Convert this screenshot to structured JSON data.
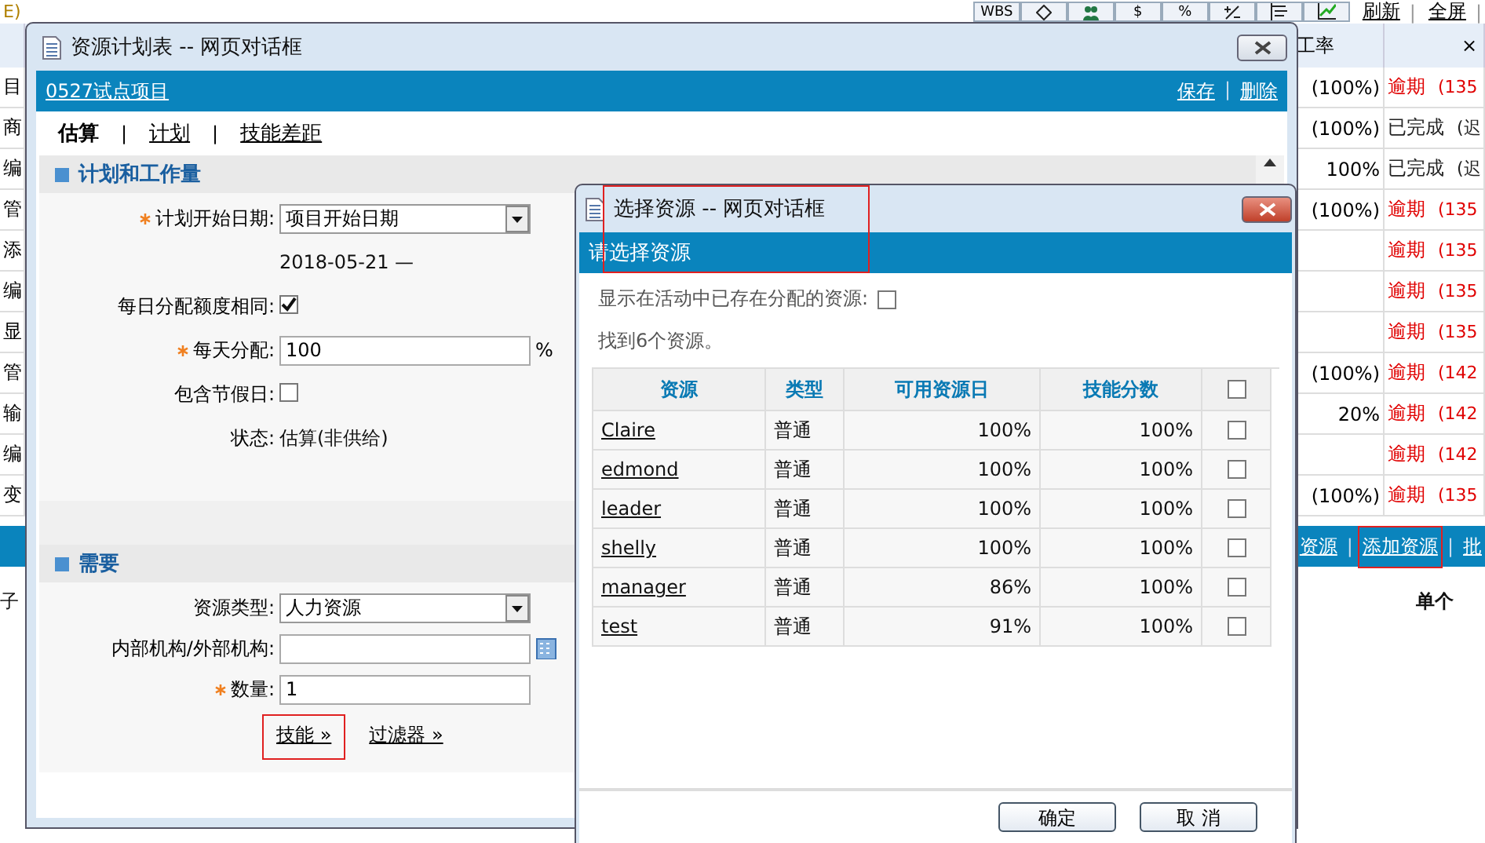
{
  "background": {
    "corner_text": "E)",
    "toolbar": [
      {
        "kind": "text",
        "label": "WBS"
      },
      {
        "kind": "diamond"
      },
      {
        "kind": "people"
      },
      {
        "kind": "text",
        "label": "$"
      },
      {
        "kind": "text",
        "label": "%"
      },
      {
        "kind": "plus-minus"
      },
      {
        "kind": "list"
      },
      {
        "kind": "chart"
      }
    ],
    "toolbar_links": [
      "刷新",
      "全屏"
    ],
    "table": {
      "columns": [
        "工率",
        "×"
      ],
      "rows": [
        {
          "column_1": "目",
          "column_2": "(100%)",
          "color": "#e00000",
          "column_3": "逾期",
          "note": "(135"
        },
        {
          "column_1": "商",
          "column_2": "(100%)",
          "color": "#222222",
          "column_3": "已完成",
          "note": "(迟"
        },
        {
          "column_1": "编",
          "column_2": "100%",
          "color": "#222222",
          "column_3": "已完成",
          "note": "(迟"
        },
        {
          "column_1": "管",
          "column_2": "(100%)",
          "color": "#e00000",
          "column_3": "逾期",
          "note": "(135"
        },
        {
          "column_1": "添",
          "color": "#e00000",
          "column_3": "逾期",
          "note": "(135"
        },
        {
          "column_1": "编",
          "color": "#e00000",
          "column_3": "逾期",
          "note": "(135"
        },
        {
          "column_1": "显",
          "color": "#e00000",
          "column_3": "逾期",
          "note": "(135"
        },
        {
          "column_1": "管",
          "column_2": "(100%)",
          "color": "#e00000",
          "column_3": "逾期",
          "note": "(142"
        },
        {
          "column_1": "输",
          "column_2": "20%",
          "color": "#e00000",
          "column_3": "逾期",
          "note": "(142"
        },
        {
          "column_1": "编",
          "color": "#e00000",
          "column_3": "逾期",
          "note": "(142"
        },
        {
          "column_1": "变",
          "column_2": "(100%)",
          "color": "#e00000",
          "column_3": "逾期",
          "note": "(135"
        }
      ]
    },
    "separator": "|",
    "action_bar": [
      {
        "label": "资源",
        "highlighted": false
      },
      {
        "label": "添加资源",
        "highlighted": true
      },
      {
        "label": "批",
        "highlighted": false
      }
    ],
    "below_left": "子",
    "below_right": "单个"
  },
  "plan_dialog": {
    "title": "资源计划表 -- 网页对话框",
    "project": "0527试点项目",
    "actions": [
      "保存",
      "删除"
    ],
    "tabs": [
      {
        "label": "估算",
        "selected": true
      },
      {
        "label": "计划",
        "selected": false
      },
      {
        "label": "技能差距",
        "selected": false
      }
    ],
    "sections": [
      {
        "title": "计划和工作量",
        "fields": [
          {
            "kind": "select",
            "label": "计划开始日期:",
            "required": true,
            "value": "项目开始日期"
          },
          {
            "kind": "text",
            "value": "2018-05-21 —"
          },
          {
            "kind": "checkbox",
            "label": "每日分配额度相同:",
            "required": false,
            "checked": true
          },
          {
            "kind": "input",
            "label": "每天分配:",
            "required": true,
            "value": "100",
            "unit": "%"
          },
          {
            "kind": "checkbox",
            "label": "包含节假日:",
            "required": false,
            "checked": false
          },
          {
            "kind": "readout",
            "label": "状态:",
            "value": "估算(非供给)"
          }
        ]
      },
      {
        "title": "需要",
        "fields": [
          {
            "kind": "select",
            "label": "资源类型:",
            "required": false,
            "value": "人力资源"
          },
          {
            "kind": "lookup",
            "label": "内部机构/外部机构:",
            "required": false
          },
          {
            "kind": "input",
            "label": "数量:",
            "required": true,
            "value": "1"
          }
        ]
      }
    ],
    "links": [
      {
        "label": "技能 »",
        "highlighted": true
      },
      {
        "label": "过滤器 »",
        "highlighted": false
      }
    ]
  },
  "select_dialog": {
    "title": "选择资源 -- 网页对话框",
    "banner": "请选择资源",
    "highlighted": true,
    "show_assigned": {
      "label": "显示在活动中已存在分配的资源:",
      "checked": false
    },
    "found": "找到6个资源。",
    "columns": [
      "资源",
      "类型",
      "可用资源日",
      "技能分数"
    ],
    "select_all": false,
    "rows": [
      {
        "name": "Claire",
        "type": "普通",
        "available": "100%",
        "skill": "100%",
        "checked": false
      },
      {
        "name": "edmond",
        "type": "普通",
        "available": "100%",
        "skill": "100%",
        "checked": false
      },
      {
        "name": "leader",
        "type": "普通",
        "available": "100%",
        "skill": "100%",
        "checked": false
      },
      {
        "name": "shelly",
        "type": "普通",
        "available": "100%",
        "skill": "100%",
        "checked": false
      },
      {
        "name": "manager",
        "type": "普通",
        "available": "86%",
        "skill": "100%",
        "checked": false
      },
      {
        "name": "test",
        "type": "普通",
        "available": "91%",
        "skill": "100%",
        "checked": false
      }
    ],
    "buttons": [
      "确定",
      "取 消"
    ]
  }
}
